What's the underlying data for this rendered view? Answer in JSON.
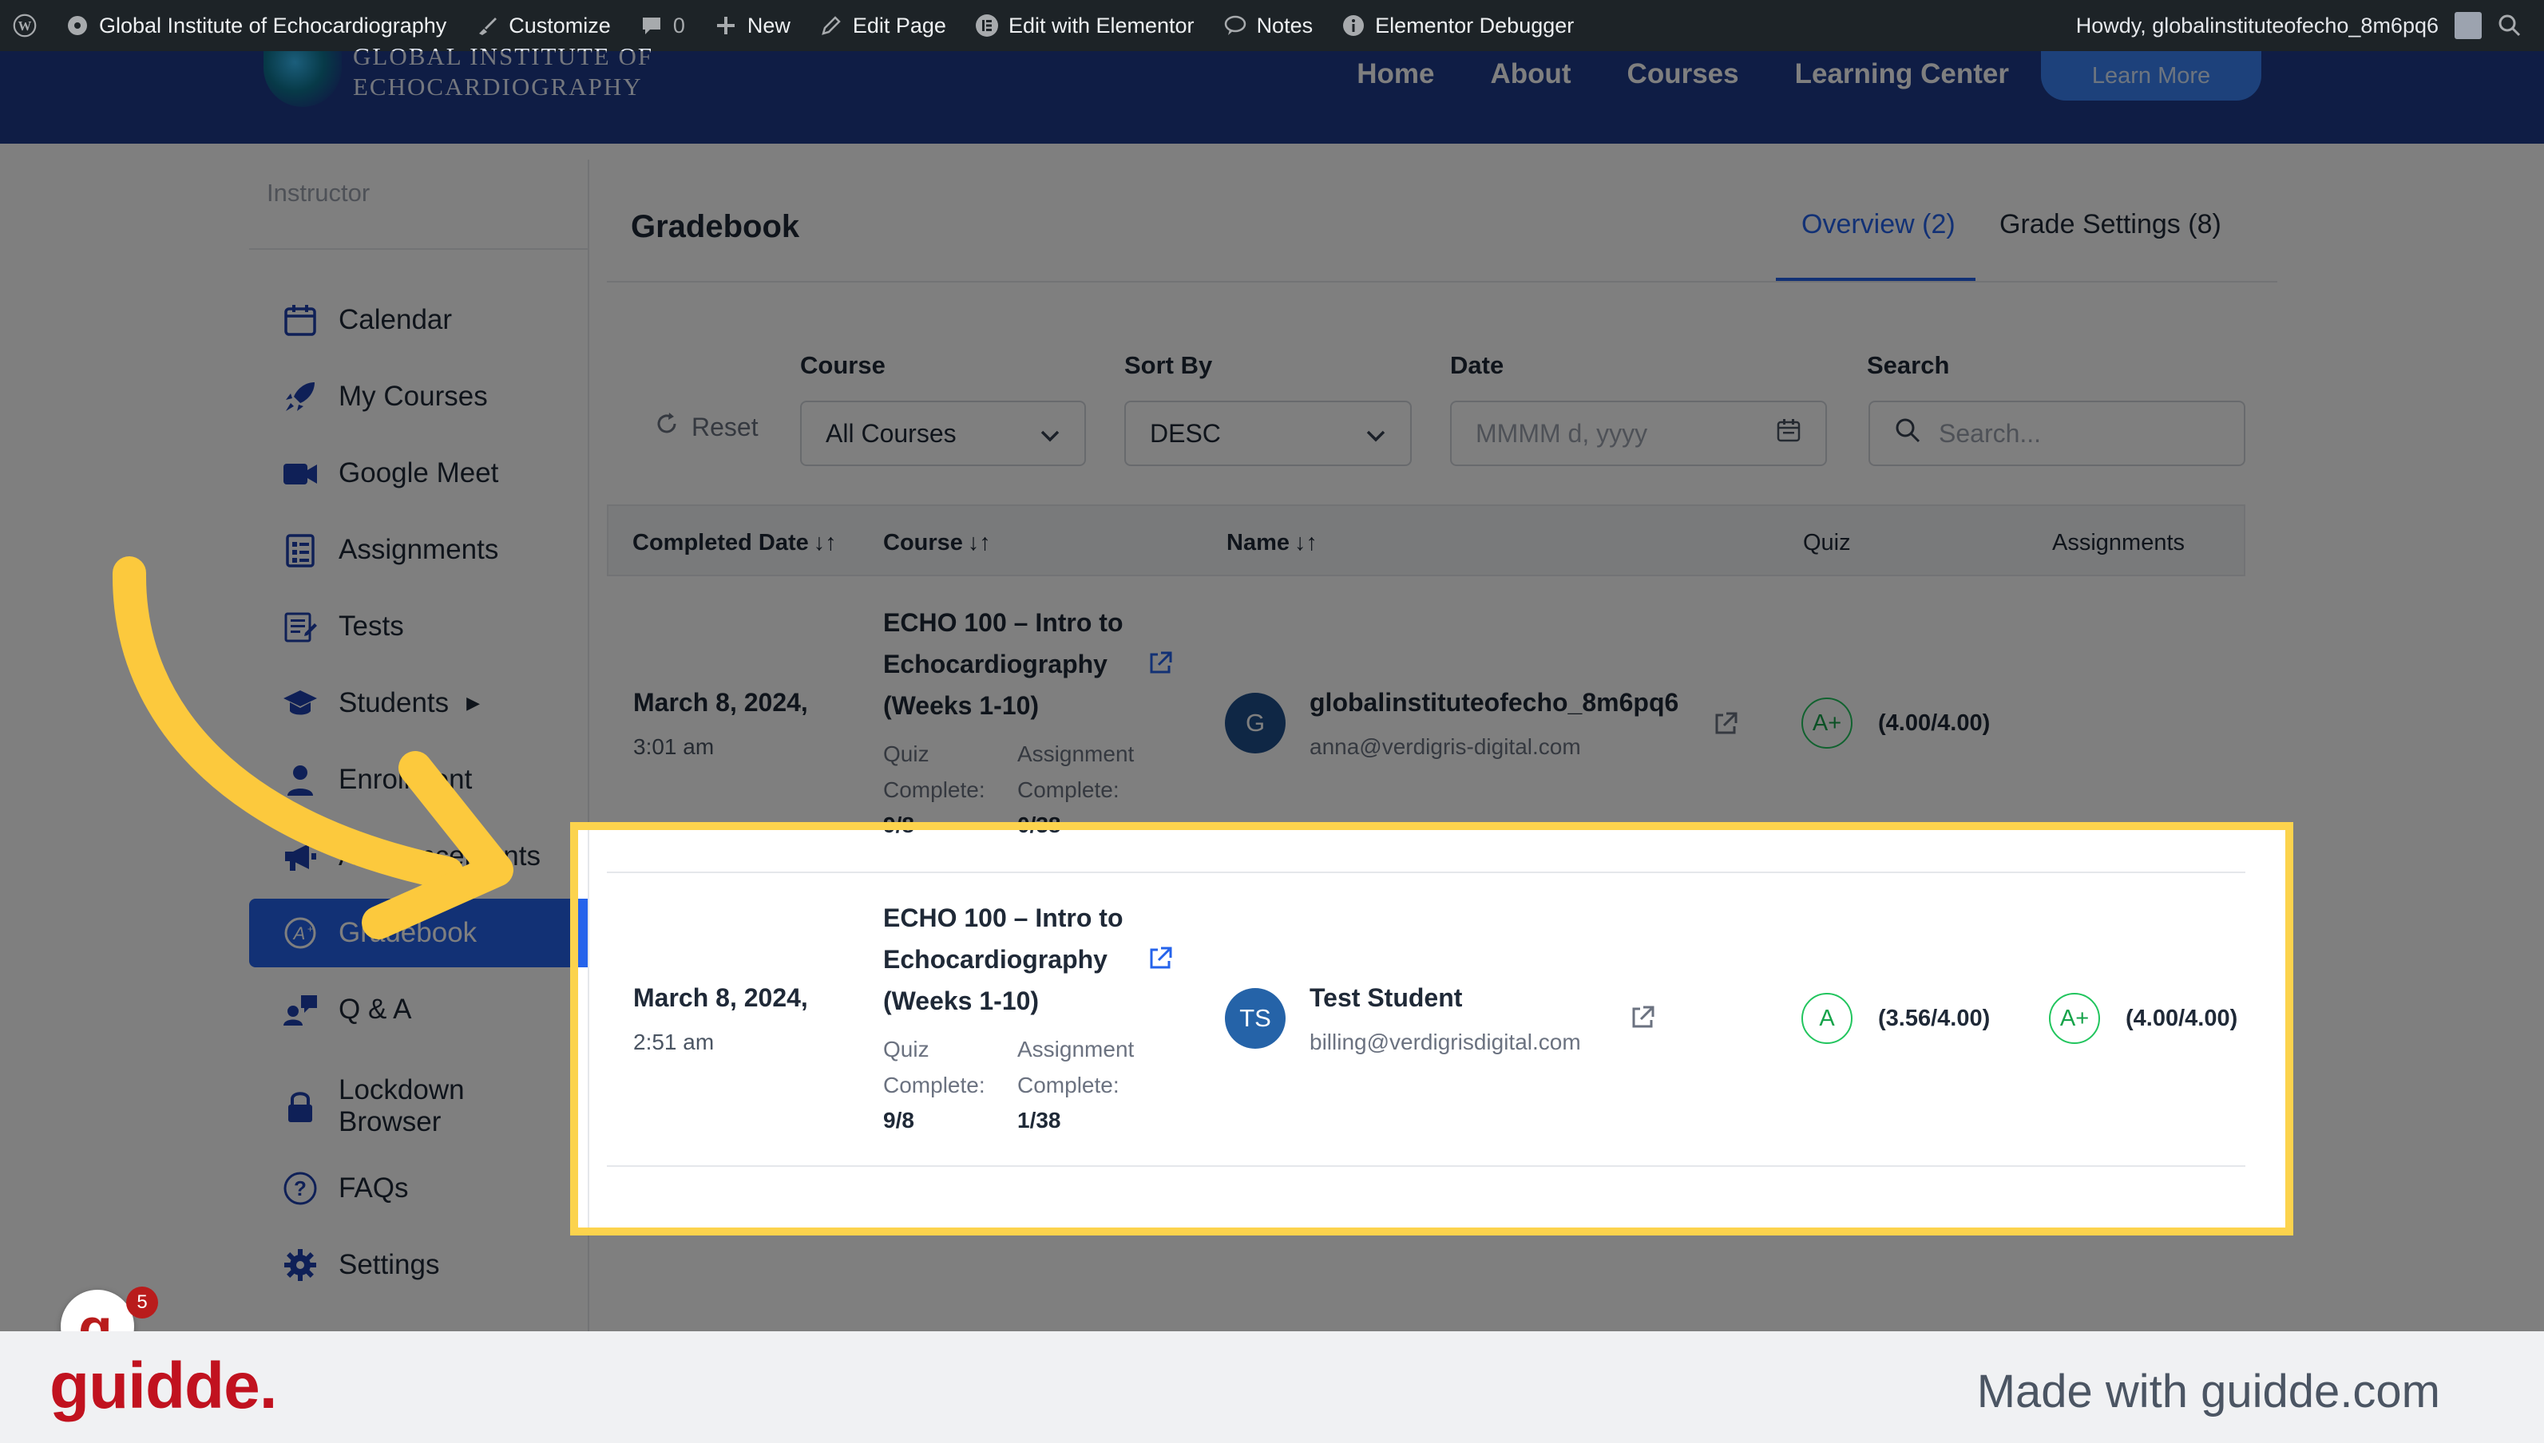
{
  "admin_bar": {
    "site_name": "Global Institute of Echocardiography",
    "customize": "Customize",
    "comments_count": "0",
    "new": "New",
    "edit_page": "Edit Page",
    "edit_elementor": "Edit with Elementor",
    "notes": "Notes",
    "debugger": "Elementor Debugger",
    "greeting": "Howdy, globalinstituteofecho_8m6pq6"
  },
  "header": {
    "logo_line1": "GLOBAL INSTITUTE OF",
    "logo_line2": "ECHOCARDIOGRAPHY",
    "nav": [
      "Home",
      "About",
      "Courses",
      "Learning Center"
    ],
    "cta": "Learn More"
  },
  "sidebar": {
    "role": "Instructor",
    "items": [
      {
        "label": "Calendar",
        "icon": "calendar-icon"
      },
      {
        "label": "My Courses",
        "icon": "rocket-icon"
      },
      {
        "label": "Google Meet",
        "icon": "video-icon"
      },
      {
        "label": "Assignments",
        "icon": "assignment-icon"
      },
      {
        "label": "Tests",
        "icon": "tests-icon"
      },
      {
        "label": "Students",
        "icon": "students-icon"
      },
      {
        "label": "Enrollment",
        "icon": "user-icon"
      },
      {
        "label": "Announcements",
        "icon": "megaphone-icon"
      },
      {
        "label": "Gradebook",
        "icon": "gradebook-icon"
      },
      {
        "label": "Q & A",
        "icon": "qa-icon"
      },
      {
        "label": "Lockdown Browser",
        "icon": "lock-icon"
      },
      {
        "label": "FAQs",
        "icon": "question-icon"
      },
      {
        "label": "Settings",
        "icon": "gear-icon"
      }
    ],
    "active_index": 8
  },
  "main": {
    "title": "Gradebook",
    "tabs": [
      "Overview (2)",
      "Grade Settings (8)"
    ],
    "filters": {
      "reset": "Reset",
      "course_label": "Course",
      "course_value": "All Courses",
      "sort_label": "Sort By",
      "sort_value": "DESC",
      "date_label": "Date",
      "date_placeholder": "MMMM d, yyyy",
      "search_label": "Search",
      "search_placeholder": "Search..."
    },
    "columns": [
      "Completed Date",
      "Course",
      "Name",
      "Quiz",
      "Assignments"
    ],
    "rows": [
      {
        "date": "March 8, 2024,",
        "time": "3:01 am",
        "course": "ECHO 100 – Intro to Echocardiography (Weeks 1-10)",
        "quiz_label": "Quiz Complete:",
        "quiz_value": "9/8",
        "assign_label": "Assignment Complete:",
        "assign_value": "0/38",
        "avatar": "G",
        "name": "globalinstituteofecho_8m6pq6",
        "email": "anna@verdigris-digital.com",
        "quiz_grade": "A+",
        "quiz_score": "(4.00/4.00)",
        "assign_grade": "",
        "assign_score": ""
      },
      {
        "date": "March 8, 2024,",
        "time": "2:51 am",
        "course": "ECHO 100 – Intro to Echocardiography (Weeks 1-10)",
        "quiz_label": "Quiz Complete:",
        "quiz_value": "9/8",
        "assign_label": "Assignment Complete:",
        "assign_value": "1/38",
        "avatar": "TS",
        "name": "Test Student",
        "email": "billing@verdigrisdigital.com",
        "quiz_grade": "A",
        "quiz_score": "(3.56/4.00)",
        "assign_grade": "A+",
        "assign_score": "(4.00/4.00)"
      }
    ]
  },
  "chat": {
    "badge": "5"
  },
  "footer": {
    "logo": "guidde.",
    "tagline": "Made with guidde.com"
  },
  "colors": {
    "accent": "#2563eb",
    "header": "#1e3a8a",
    "highlight": "#fcd34d",
    "arrow": "#fcc93d",
    "brand": "#c1121f"
  }
}
